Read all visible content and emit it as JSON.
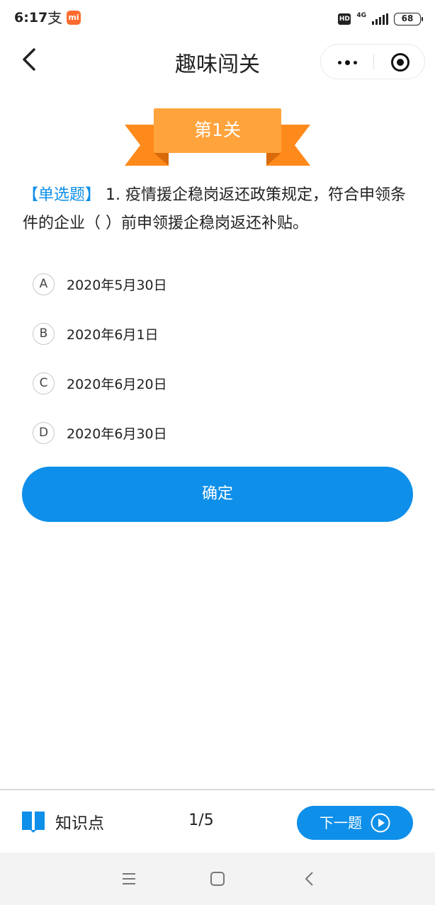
{
  "status_bar": {
    "time": "6:17",
    "network": "4G",
    "hd": "HD",
    "battery": "68",
    "app_icon_text": "mi"
  },
  "nav": {
    "title": "趣味闯关"
  },
  "level": {
    "label": "第1关"
  },
  "question": {
    "type_label": "【单选题】",
    "text": " 1. 疫情援企稳岗返还政策规定，符合申领条件的企业（ ）前申领援企稳岗返还补贴。"
  },
  "options": [
    {
      "letter": "A",
      "text": "2020年5月30日"
    },
    {
      "letter": "B",
      "text": "2020年6月1日"
    },
    {
      "letter": "C",
      "text": "2020年6月20日"
    },
    {
      "letter": "D",
      "text": "2020年6月30日"
    }
  ],
  "confirm": {
    "label": "确定"
  },
  "bottom": {
    "knowledge_label": "知识点",
    "progress": "1/5",
    "next_label": "下一题"
  },
  "colors": {
    "accent": "#0e8fe9",
    "ribbon_front": "#ffa33d",
    "ribbon_back": "#ff8a1c"
  },
  "icons": {
    "back": "chevron-left-icon",
    "more": "more-dots-icon",
    "close": "target-icon",
    "knowledge": "book-icon",
    "next": "play-circle-icon",
    "sys_menu": "menu-icon",
    "sys_home": "square-icon",
    "sys_back": "chevron-left-icon"
  }
}
